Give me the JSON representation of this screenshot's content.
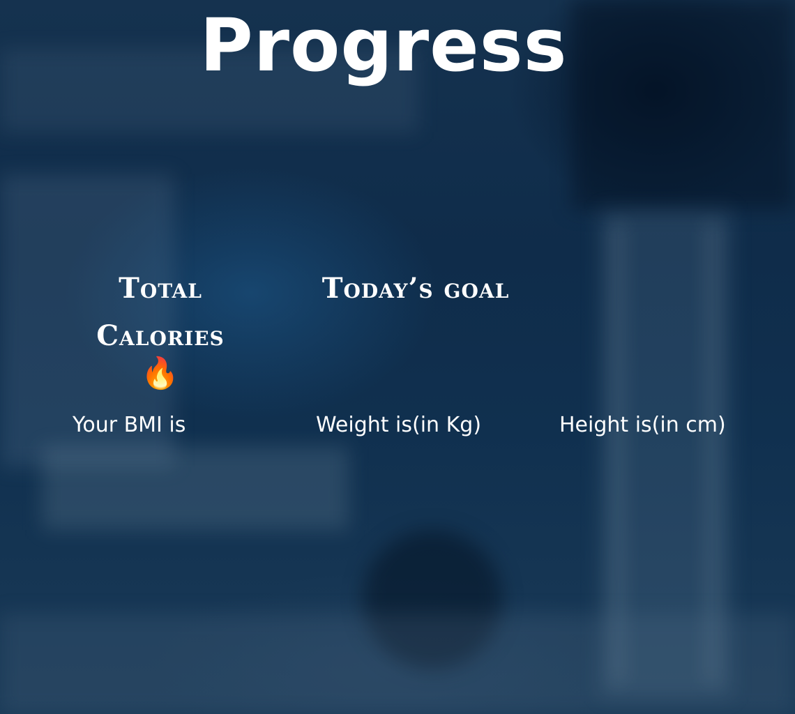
{
  "page": {
    "title": "Progress"
  },
  "stats": {
    "total_calories": {
      "heading": "Total Calories",
      "icon": "fire-icon",
      "icon_glyph": "🔥"
    },
    "todays_goal": {
      "heading": "Today’s goal"
    }
  },
  "metrics": {
    "bmi_label": "Your BMI is",
    "weight_label": "Weight is(in Kg)",
    "height_label": "Height is(in cm)"
  },
  "colors": {
    "text": "#ffffff",
    "background_tint": "#0f2c4a"
  }
}
